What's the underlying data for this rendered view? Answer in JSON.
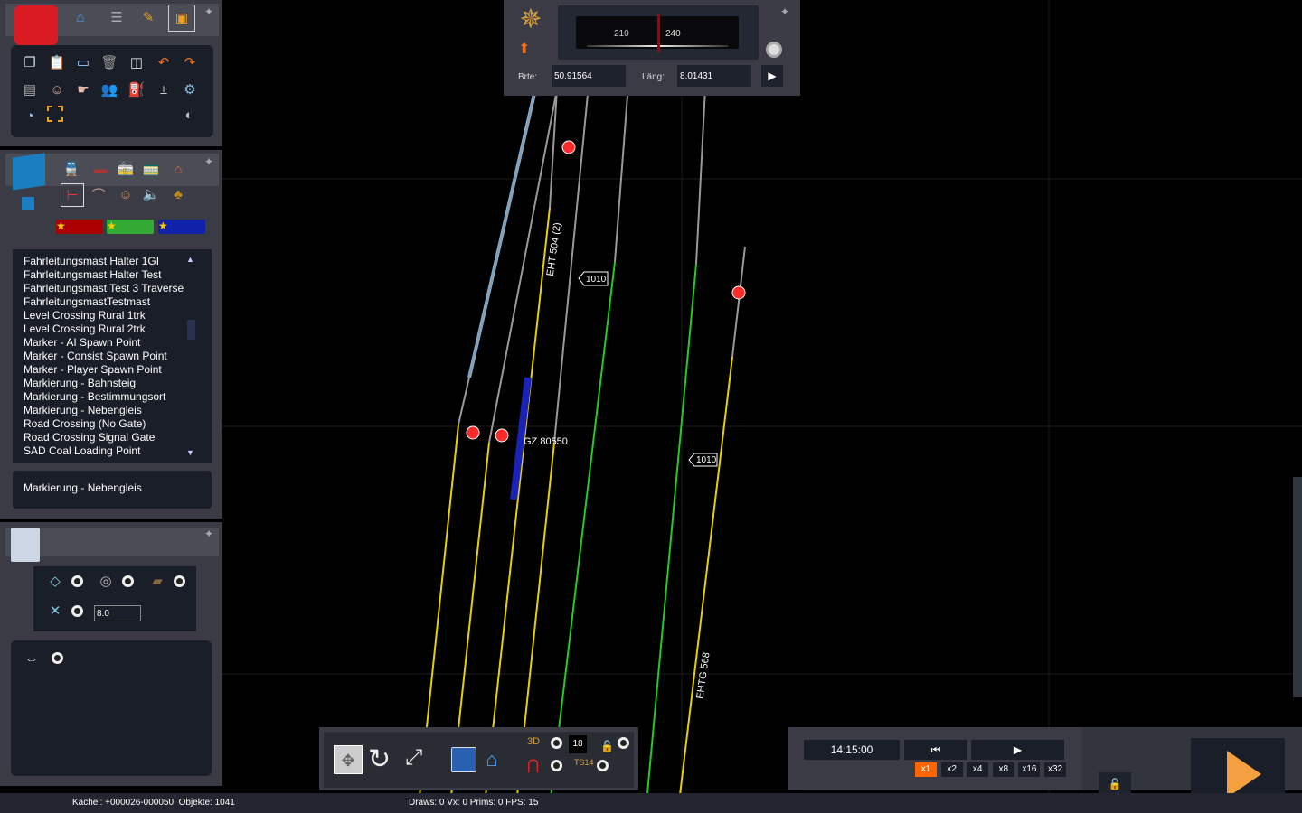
{
  "toolbar_main": {
    "icons": [
      "toolbox-icon",
      "home-icon",
      "track-icon",
      "brush-icon",
      "train-icon"
    ]
  },
  "tools": {
    "icons": [
      "copy-icon",
      "paste-icon",
      "monitor-icon",
      "trash-icon",
      "measure-icon",
      "undo-icon",
      "redo-icon",
      "consist-icon",
      "driver-icon",
      "pointer-icon",
      "people-icon",
      "loading-icon",
      "add-vehicle-icon",
      "settings-icon",
      "clock-icon",
      "select-rect-icon",
      "flashlight-icon"
    ]
  },
  "object_browser": {
    "list_items": [
      "Fahrleitungsmast Halter 1GI",
      "Fahrleitungsmast Halter Test",
      "Fahrleitungsmast Test 3 Traverse",
      "FahrleitungsmastTestmast",
      "Level Crossing Rural 1trk",
      "Level Crossing Rural 2trk",
      "Marker - AI Spawn Point",
      "Marker - Consist Spawn Point",
      "Marker - Player Spawn Point",
      "Markierung - Bahnsteig",
      "Markierung - Bestimmungsort",
      "Markierung - Nebengleis",
      "Road Crossing (No Gate)",
      "Road Crossing Signal Gate",
      "SAD Coal Loading Point"
    ],
    "selected": "Markierung - Nebengleis"
  },
  "properties": {
    "value": "8.0"
  },
  "compass": {
    "tick_210": "210",
    "tick_240": "240",
    "lat_label": "Brte:",
    "lat_value": "50.91564",
    "lon_label": "Läng:",
    "lon_value": "8.01431"
  },
  "map": {
    "track_label_1": "EHT 504 (2)",
    "track_label_2": "EHTG 568",
    "train_label": "GZ 80550",
    "marker_1": "1010",
    "marker_2": "1010"
  },
  "bottom_tools": {
    "counter": "18",
    "ts14": "TS14",
    "label_3d": "3D"
  },
  "time": {
    "clock": "14:15:00",
    "speeds": [
      "x1",
      "x2",
      "x4",
      "x8",
      "x16",
      "x32"
    ],
    "active_speed": "x1",
    "accent": "#ff6600"
  },
  "status": {
    "left": "Kachel: +000026-000050  Objekte: 1041",
    "center": "Draws: 0 Vx: 0 Prims: 0 FPS: 15"
  }
}
